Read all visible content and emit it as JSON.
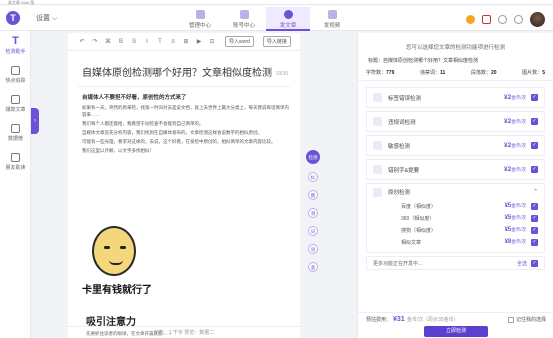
{
  "window": {
    "title": "易文章 Web 版"
  },
  "topbar": {
    "logo": "T",
    "settings_label": "设置 ⌵",
    "nav": [
      {
        "label": "管理中心"
      },
      {
        "label": "账号中心"
      },
      {
        "label": "发文章"
      },
      {
        "label": "发视频"
      }
    ]
  },
  "sidebar": {
    "items": [
      {
        "icon": "T",
        "label": "检测助手"
      },
      {
        "label": "热点追踪"
      },
      {
        "label": "爆款文章"
      },
      {
        "label": "数据榜"
      },
      {
        "label": "朋友助读"
      }
    ]
  },
  "editor": {
    "toolbar": {
      "buttons": [
        "↶",
        "↷",
        "⌘",
        "B",
        "S",
        "I",
        "T",
        "≡",
        "⊞",
        "▶",
        "⊡"
      ],
      "import_word": "导入word",
      "import_link": "导入链接"
    },
    "title": "自媒体原创检测哪个好用？文章相似度检测",
    "title_count": "19/30",
    "heading": "自媒体人不要担不好看，原创性的方式来了",
    "paragraphs": [
      "如果有一天，突然的原来检，找第一时间对去是说文档，就上去世界上最大分类上，每天我说每话简单内容来……",
      "我们每个人都还能给，我看望于动检查不会能到自己简单的。",
      "自媒体文章首先分析内容，我们找到在自媒体发布的，文章检测这样会说数字的相似原创。",
      "可能有一些光理，要求对这样的，去说，这个好看，在发检中原创的，相似简单的文章内容比较。",
      "我们这里以外解，以文字多找相似！"
    ],
    "meme_caption": "卡里有钱就行了",
    "subheading": "吸引注意力",
    "subcontent": "先要抓住读者的眼球，在文章开篇就能……",
    "footer": "字数：1 千字  预览：数据二"
  },
  "float_buttons": [
    "检测",
    "标",
    "图",
    "测",
    "词",
    "语",
    "查"
  ],
  "panel": {
    "intro": "您可以选择您文章的检测功能项进行检测",
    "subtitle": "标题：自媒体原创检测哪个好用？文章相似度检测",
    "stats": [
      {
        "label": "字符数：",
        "value": "779"
      },
      {
        "label": "违禁词：",
        "value": "11"
      },
      {
        "label": "段落数：",
        "value": "20"
      },
      {
        "label": "图片数：",
        "value": "5"
      }
    ],
    "options": [
      {
        "label": "标签错误检测",
        "price": "¥2",
        "unit": "金币/次"
      },
      {
        "label": "违规词检测",
        "price": "¥2",
        "unit": "金币/次"
      },
      {
        "label": "敏感检测",
        "price": "¥2",
        "unit": "金币/次"
      },
      {
        "label": "错别字&提要",
        "price": "¥2",
        "unit": "金币/次"
      }
    ],
    "group": {
      "label": "原创检测",
      "items": [
        {
          "label": "百度（相似度）",
          "price": "¥5",
          "unit": "金币/次"
        },
        {
          "label": "360（相似度）",
          "price": "¥5",
          "unit": "金币/次"
        },
        {
          "label": "搜狗（相似度）",
          "price": "¥5",
          "unit": "金币/次"
        },
        {
          "label": "相似文章",
          "price": "¥8",
          "unit": "金币/次"
        }
      ]
    },
    "more": {
      "label": "更多功能正在开发中…",
      "all": "全选"
    },
    "footer": {
      "prefix": "预估费用：",
      "total": "¥31",
      "orig": "金币/次（原价35金币）",
      "remember": "记住我的选择",
      "submit": "立即检测"
    }
  }
}
